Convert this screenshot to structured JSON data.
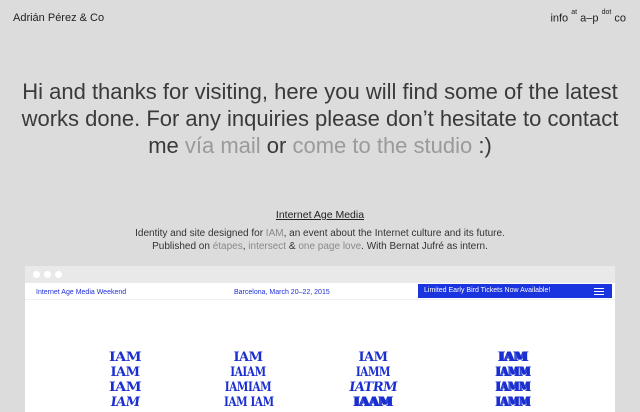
{
  "header": {
    "brand": "Adrián Pérez & Co",
    "contact_info": "info",
    "contact_at": "at",
    "contact_domain": "a–p",
    "contact_dot": "dot",
    "contact_tld": "co"
  },
  "hero": {
    "line_1": "Hi and thanks for visiting, here you will find some of the latest",
    "line_2": "works done. For any inquiries please don’t hesitate to contact",
    "line_3_pre": "me ",
    "mail_link": "vía mail",
    "or_text": " or ",
    "studio_link": "come to the studio",
    "line_3_post": " :)"
  },
  "project": {
    "title": "Internet Age Media",
    "desc_1_pre": "Identity and site designed for ",
    "desc_1_link": "IAM",
    "desc_1_post": ", an event about the Internet culture and its future.",
    "desc_2_pre": "Published on ",
    "pub_1": "étapes",
    "sep_1": ", ",
    "pub_2": "intersect",
    "sep_2": " & ",
    "pub_3": "one page love",
    "desc_2_post": ". With Bernat Jufré as intern."
  },
  "browser": {
    "site_title": "Internet Age Media Weekend",
    "site_date": "Barcelona, March 20–22, 2015",
    "cta_label": "Limited Early Bird Tickets Now Available!",
    "logo_columns": [
      [
        "IAM",
        "IAM",
        "IAM",
        "IAM"
      ],
      [
        "IAM",
        "IAIAM",
        "IAMIAM",
        "IAM IAM"
      ],
      [
        "IAM",
        "IAMM",
        "IATRM",
        "IAAM"
      ],
      [
        "IAM",
        "IAMM",
        "IAMM",
        "IAMM"
      ]
    ]
  },
  "colors": {
    "background": "#dcdcdc",
    "accent_blue": "#1a35e0",
    "link_grey": "#9a9a9a"
  }
}
